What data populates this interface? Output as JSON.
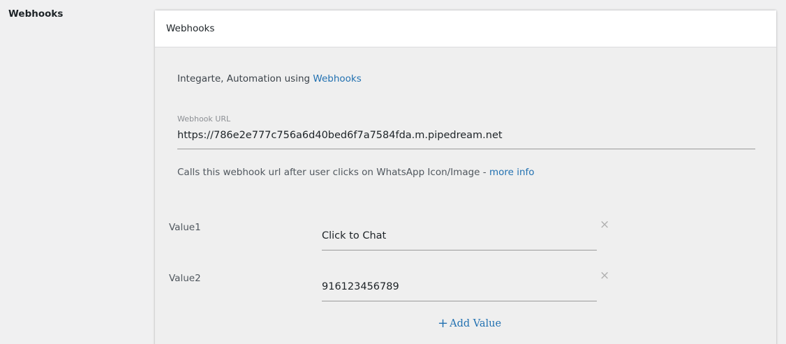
{
  "section": {
    "heading": "Webhooks"
  },
  "card": {
    "title": "Webhooks",
    "intro_text": "Integarte, Automation using ",
    "intro_link": "Webhooks",
    "url_label": "Webhook URL",
    "url_value": "https://786e2e777c756a6d40bed6f7a7584fda.m.pipedream.net",
    "helper_text": "Calls this webhook url after user clicks on WhatsApp Icon/Image - ",
    "helper_link": "more info",
    "values": [
      {
        "label": "Value1",
        "value": "Click to Chat",
        "remove_icon": "close-icon"
      },
      {
        "label": "Value2",
        "value": "916123456789",
        "remove_icon": "close-icon"
      }
    ],
    "add_value_label": "Add Value",
    "add_icon": "plus-icon"
  },
  "colors": {
    "link": "#2271b1",
    "page_bg": "#f0f0f1",
    "card_bg": "#efefef",
    "header_bg": "#ffffff"
  }
}
